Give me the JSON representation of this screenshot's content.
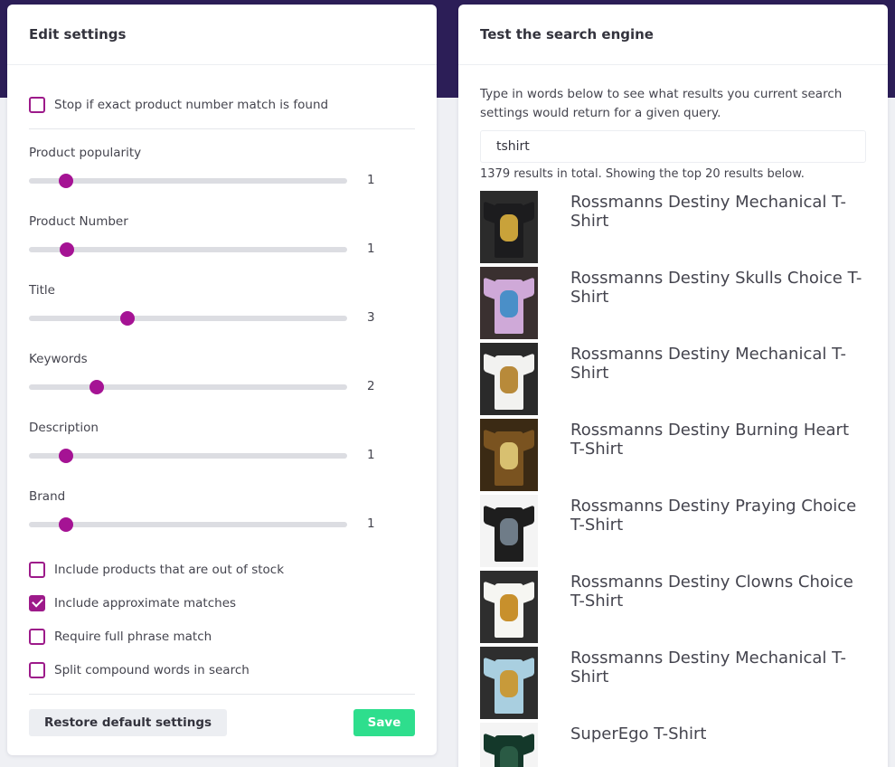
{
  "settings": {
    "title": "Edit settings",
    "stop_exact": {
      "label": "Stop if exact product number match is found",
      "checked": false
    },
    "sliders": [
      {
        "label": "Product popularity",
        "value": 1,
        "fraction": 0.117
      },
      {
        "label": "Product Number",
        "value": 1,
        "fraction": 0.119
      },
      {
        "label": "Title",
        "value": 3,
        "fraction": 0.31
      },
      {
        "label": "Keywords",
        "value": 2,
        "fraction": 0.213
      },
      {
        "label": "Description",
        "value": 1,
        "fraction": 0.117
      },
      {
        "label": "Brand",
        "value": 1,
        "fraction": 0.117
      }
    ],
    "options": [
      {
        "label": "Include products that are out of stock",
        "checked": false
      },
      {
        "label": "Include approximate matches",
        "checked": true
      },
      {
        "label": "Require full phrase match",
        "checked": false
      },
      {
        "label": "Split compound words in search",
        "checked": false
      }
    ],
    "restore_label": "Restore default settings",
    "save_label": "Save"
  },
  "search": {
    "title": "Test the search engine",
    "intro": "Type in words below to see what results you current search settings would return for a given query.",
    "query": "tshirt",
    "summary": "1379 results in total. Showing the top 20 results below.",
    "results": [
      {
        "title": "Rossmanns Destiny Mechanical T-Shirt",
        "shirt_color": "#1c1c1e",
        "print_color": "#c9a23a",
        "bg": "#2b2b2b"
      },
      {
        "title": "Rossmanns Destiny Skulls Choice T-Shirt",
        "shirt_color": "#cfa9d8",
        "print_color": "#4a8fc8",
        "bg": "#3a3030"
      },
      {
        "title": "Rossmanns Destiny Mechanical T-Shirt",
        "shirt_color": "#f2f2f0",
        "print_color": "#b88a3a",
        "bg": "#2a2a2a"
      },
      {
        "title": "Rossmanns Destiny Burning Heart T-Shirt",
        "shirt_color": "#7a5320",
        "print_color": "#d8c070",
        "bg": "#3b2a14"
      },
      {
        "title": "Rossmanns Destiny Praying Choice T-Shirt",
        "shirt_color": "#1e1e1e",
        "print_color": "#6f7c88",
        "bg": "#f4f4f4"
      },
      {
        "title": "Rossmanns Destiny Clowns Choice T-Shirt",
        "shirt_color": "#f6f6f2",
        "print_color": "#c8902c",
        "bg": "#2e2e2e"
      },
      {
        "title": "Rossmanns Destiny Mechanical T-Shirt",
        "shirt_color": "#a9cfe0",
        "print_color": "#c89a3a",
        "bg": "#2e2e2e"
      },
      {
        "title": "SuperEgo T-Shirt",
        "shirt_color": "#14382a",
        "print_color": "#2a5a44",
        "bg": "#f4f4f4"
      }
    ]
  },
  "colors": {
    "accent": "#a51394",
    "save": "#2ede8d",
    "band": "#2c1e57"
  }
}
